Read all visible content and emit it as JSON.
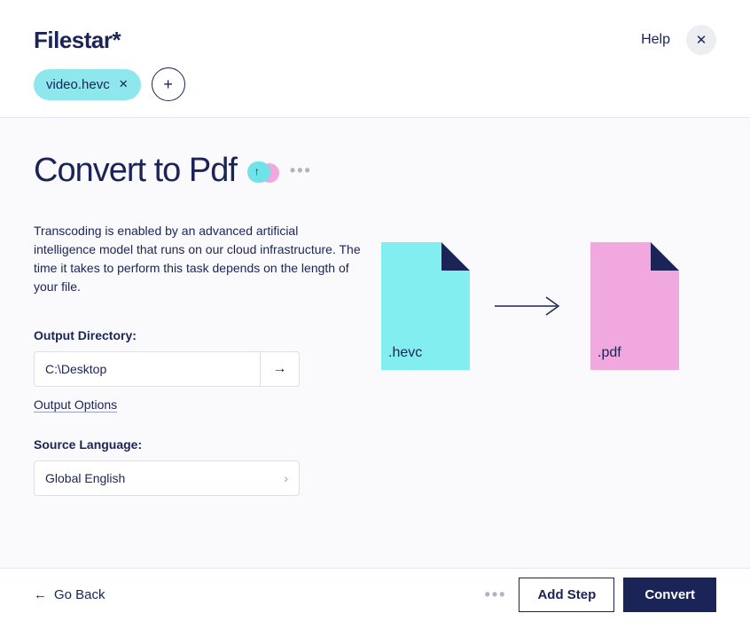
{
  "header": {
    "logo": "Filestar*",
    "help": "Help"
  },
  "chips": {
    "file_name": "video.hevc"
  },
  "main": {
    "title": "Convert to Pdf",
    "description": "Transcoding is enabled by an advanced artificial intelligence model that runs on our cloud infrastructure. The time it takes to perform this task depends on the length of your file.",
    "output_dir_label": "Output Directory:",
    "output_dir_value": "C:\\Desktop",
    "output_options": "Output Options",
    "source_lang_label": "Source Language:",
    "source_lang_value": "Global English",
    "illustration": {
      "from_ext": ".hevc",
      "to_ext": ".pdf"
    }
  },
  "footer": {
    "go_back": "Go Back",
    "add_step": "Add Step",
    "convert": "Convert"
  }
}
